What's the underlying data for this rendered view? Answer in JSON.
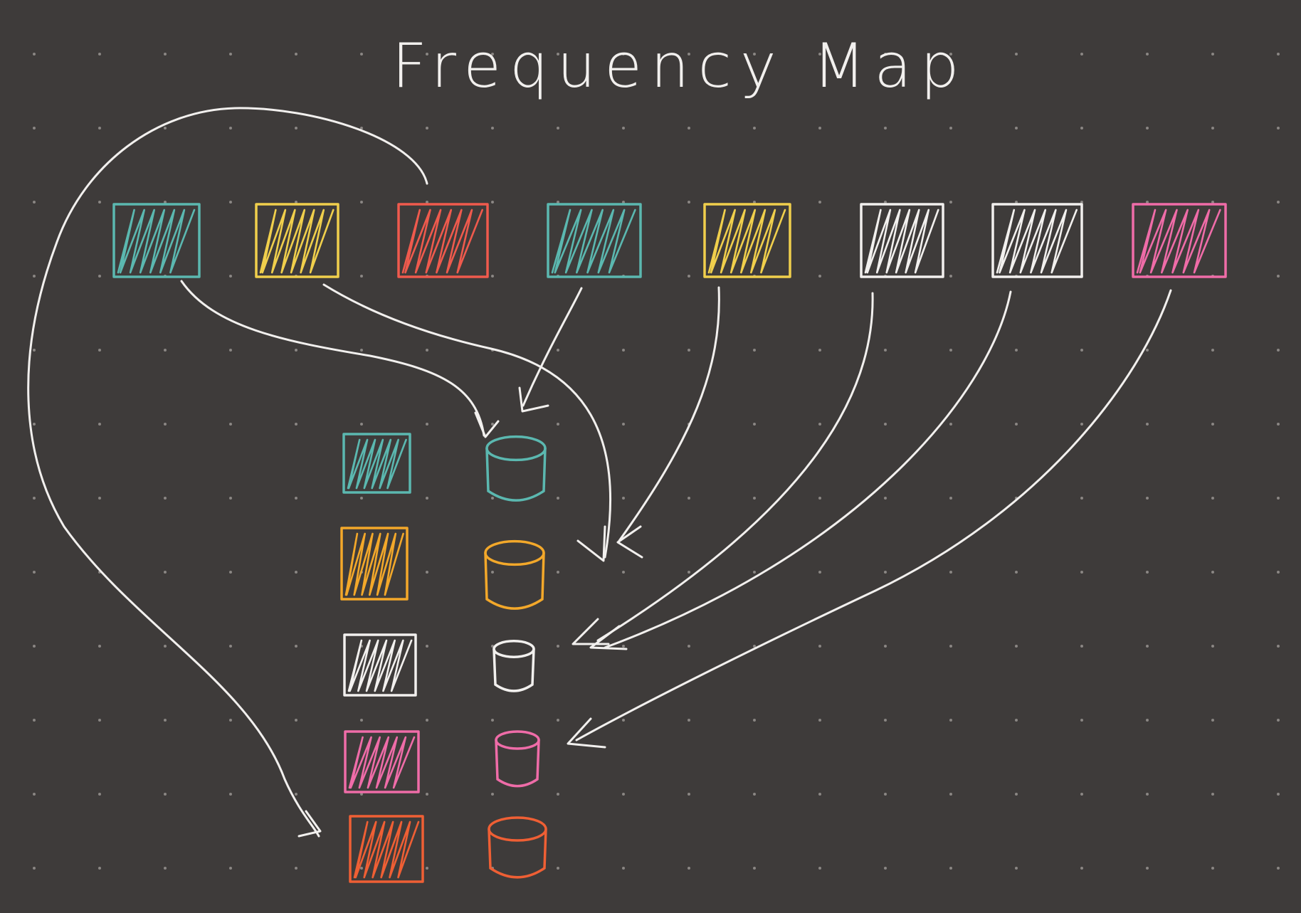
{
  "title": "Frequency Map",
  "colors": {
    "background": "#3e3b3a",
    "grid_dot": "#8a8683",
    "arrow": "#f2f0ee",
    "teal": "#5bb8b0",
    "yellow": "#f0cf4c",
    "red": "#ef5a4d",
    "orange": "#f3a82a",
    "white": "#f2f0ee",
    "pink": "#ef6ca8",
    "deep_orange": "#ef5f34"
  },
  "source_row": [
    {
      "color": "teal"
    },
    {
      "color": "yellow"
    },
    {
      "color": "red"
    },
    {
      "color": "teal"
    },
    {
      "color": "yellow"
    },
    {
      "color": "white"
    },
    {
      "color": "white"
    },
    {
      "color": "pink"
    }
  ],
  "buckets": [
    {
      "color": "teal"
    },
    {
      "color": "orange"
    },
    {
      "color": "white"
    },
    {
      "color": "pink"
    },
    {
      "color": "deep_orange"
    }
  ]
}
